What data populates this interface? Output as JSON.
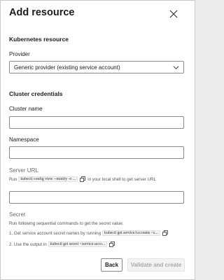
{
  "dialog": {
    "title": "Add resource",
    "close_icon": "close-icon"
  },
  "kubernetes": {
    "heading": "Kubernetes resource",
    "provider_label": "Provider",
    "provider_value": "Generic provider (existing service account)"
  },
  "credentials": {
    "heading": "Cluster credentials",
    "cluster_name_label": "Cluster name",
    "cluster_name_value": "",
    "namespace_label": "Namespace",
    "namespace_value": "",
    "server_url_label": "Server URL",
    "server_url_hint_pre": "Run",
    "server_url_command": "kubectl config view --minify -o ...",
    "server_url_hint_post": "in your local shell to get server URL",
    "server_url_value": "",
    "secret_label": "Secret",
    "secret_intro": "Run following sequential commands to get the secret value:",
    "step1_pre": "1. Get service account secret names by running",
    "step1_command": "kubectl get serviceAccounts <s...",
    "step2_pre": "2. Use the output in",
    "step2_command": "kubectl get secret <service-acco..."
  },
  "footer": {
    "back_label": "Back",
    "create_label": "Validate and create"
  },
  "colors": {
    "border": "#8a8a8a",
    "disabled_bg": "#f3f3f3",
    "disabled_text": "#a8a8a8"
  }
}
